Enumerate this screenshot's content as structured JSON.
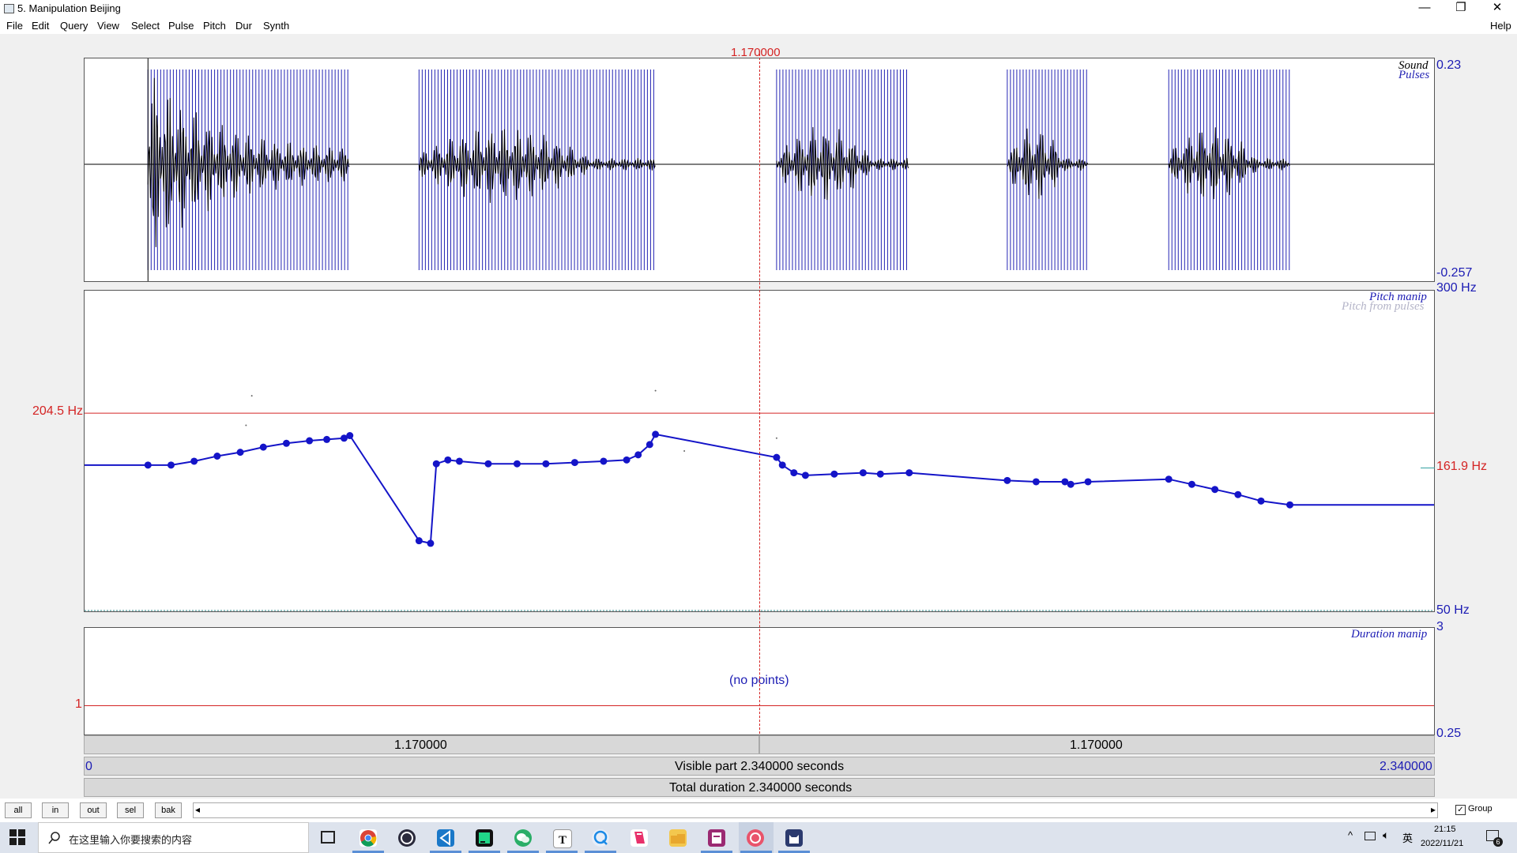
{
  "window": {
    "title": "5. Manipulation Beijing",
    "minimize": "—",
    "restore": "❐",
    "close": "✕"
  },
  "menu": [
    "File",
    "Edit",
    "Query",
    "View",
    "Select",
    "Pulse",
    "Pitch",
    "Dur",
    "Synth"
  ],
  "menu_help": "Help",
  "cursor": {
    "time_label": "1.170000"
  },
  "sound_panel": {
    "labels": [
      "Sound",
      "Pulses"
    ],
    "max": "0.23",
    "min": "-0.257",
    "voiced_segments_s": [
      [
        0.11,
        0.46
      ],
      [
        0.58,
        0.99
      ],
      [
        1.2,
        1.43
      ],
      [
        1.6,
        1.74
      ],
      [
        1.88,
        2.09
      ]
    ],
    "colors": {
      "pulse": "#2525b4",
      "waveform": "#000000"
    }
  },
  "pitch_panel": {
    "labels": [
      "Pitch manip",
      "Pitch from pulses"
    ],
    "top": "300 Hz",
    "bottom": "50 Hz",
    "ref_left": "204.5 Hz",
    "ref_right": "161.9 Hz",
    "range_hz": [
      50,
      300
    ],
    "ref_hz": 204.5,
    "points": [
      [
        0.0,
        164
      ],
      [
        0.11,
        164
      ],
      [
        0.15,
        164
      ],
      [
        0.19,
        167
      ],
      [
        0.23,
        171
      ],
      [
        0.27,
        174
      ],
      [
        0.31,
        178
      ],
      [
        0.35,
        181
      ],
      [
        0.39,
        183
      ],
      [
        0.42,
        184
      ],
      [
        0.45,
        185
      ],
      [
        0.46,
        187
      ],
      [
        0.58,
        105
      ],
      [
        0.6,
        103
      ],
      [
        0.61,
        165
      ],
      [
        0.63,
        168
      ],
      [
        0.65,
        167
      ],
      [
        0.7,
        165
      ],
      [
        0.75,
        165
      ],
      [
        0.8,
        165
      ],
      [
        0.85,
        166
      ],
      [
        0.9,
        167
      ],
      [
        0.94,
        168
      ],
      [
        0.96,
        172
      ],
      [
        0.98,
        180
      ],
      [
        0.99,
        188
      ],
      [
        1.2,
        170
      ],
      [
        1.21,
        164
      ],
      [
        1.23,
        158
      ],
      [
        1.25,
        156
      ],
      [
        1.3,
        157
      ],
      [
        1.35,
        158
      ],
      [
        1.38,
        157
      ],
      [
        1.43,
        158
      ],
      [
        1.6,
        152
      ],
      [
        1.65,
        151
      ],
      [
        1.7,
        151
      ],
      [
        1.71,
        149
      ],
      [
        1.74,
        151
      ],
      [
        1.88,
        153
      ],
      [
        1.92,
        149
      ],
      [
        1.96,
        145
      ],
      [
        2.0,
        141
      ],
      [
        2.04,
        136
      ],
      [
        2.09,
        133
      ],
      [
        2.34,
        133
      ]
    ],
    "ghost_points": [
      [
        0.29,
        218
      ],
      [
        0.28,
        195
      ],
      [
        0.99,
        222
      ],
      [
        1.2,
        185
      ],
      [
        1.04,
        175
      ]
    ],
    "colors": {
      "line": "#1414c8",
      "ref": "#d42424"
    }
  },
  "duration_panel": {
    "label": "Duration manip",
    "top": "3",
    "bottom": "0.25",
    "ref": "1",
    "empty": "(no points)"
  },
  "time_bars": {
    "left_seg": "1.170000",
    "right_seg": "1.170000",
    "start": "0",
    "visible": "Visible part 2.340000 seconds",
    "end": "2.340000",
    "total": "Total duration 2.340000 seconds"
  },
  "buttons": [
    "all",
    "in",
    "out",
    "sel",
    "bak"
  ],
  "scroll": {
    "left": "◂",
    "right": "▸"
  },
  "group": {
    "checked": true,
    "label": "Group",
    "check": "✓"
  },
  "taskbar": {
    "search_placeholder": "在这里输入你要搜索的内容",
    "time": "21:15",
    "date": "2022/11/21",
    "ime": "英",
    "notify_count": "6",
    "apps": [
      "task-view",
      "chrome",
      "obs",
      "vscode",
      "pycharm",
      "wechat",
      "typora",
      "qq",
      "edit-app",
      "file-explorer",
      "pdf-app",
      "music-app",
      "cat-app"
    ]
  }
}
